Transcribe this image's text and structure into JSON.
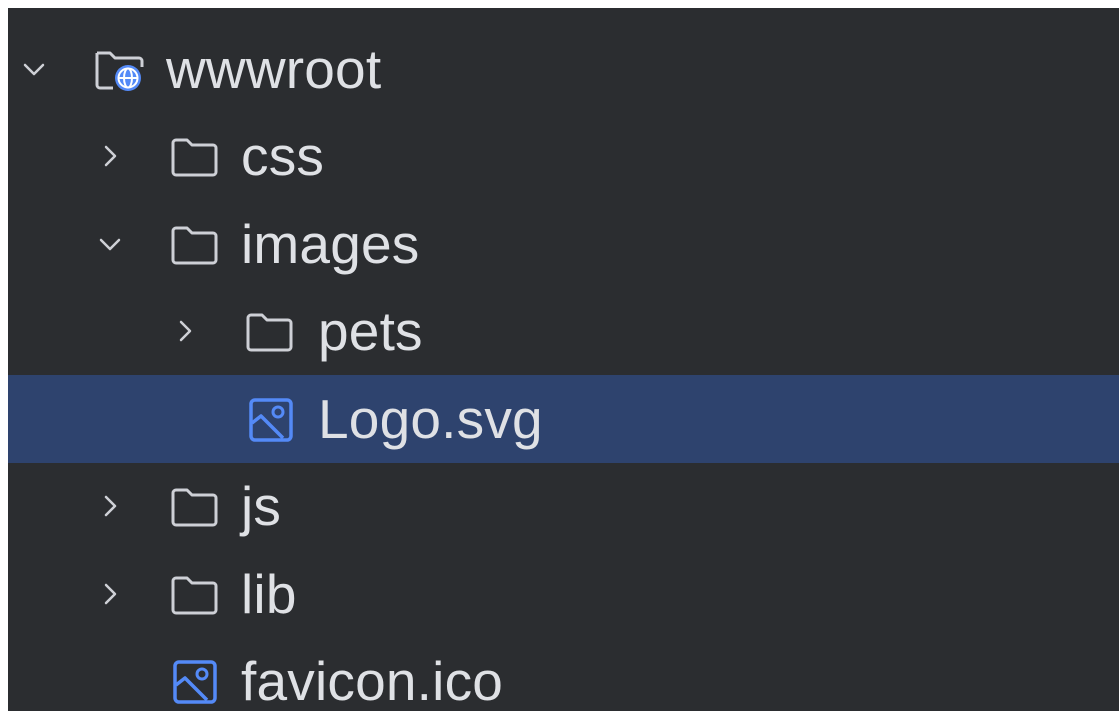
{
  "tree": {
    "items": [
      {
        "label": "wwwroot",
        "icon": "web-folder-icon",
        "expanded": true,
        "level": 0
      },
      {
        "label": "css",
        "icon": "folder-icon",
        "expanded": false,
        "level": 1
      },
      {
        "label": "images",
        "icon": "folder-icon",
        "expanded": true,
        "level": 1
      },
      {
        "label": "pets",
        "icon": "folder-icon",
        "expanded": false,
        "level": 2
      },
      {
        "label": "Logo.svg",
        "icon": "image-file-icon",
        "selected": true,
        "level": 3
      },
      {
        "label": "js",
        "icon": "folder-icon",
        "expanded": false,
        "level": 1
      },
      {
        "label": "lib",
        "icon": "folder-icon",
        "expanded": false,
        "level": 1
      },
      {
        "label": "favicon.ico",
        "icon": "image-file-icon",
        "level": 2
      }
    ]
  },
  "colors": {
    "background": "#2b2d30",
    "selection": "#2e436e",
    "text": "#dfe1e5",
    "icon_outline": "#ced0d6",
    "image_icon": "#548af7"
  }
}
